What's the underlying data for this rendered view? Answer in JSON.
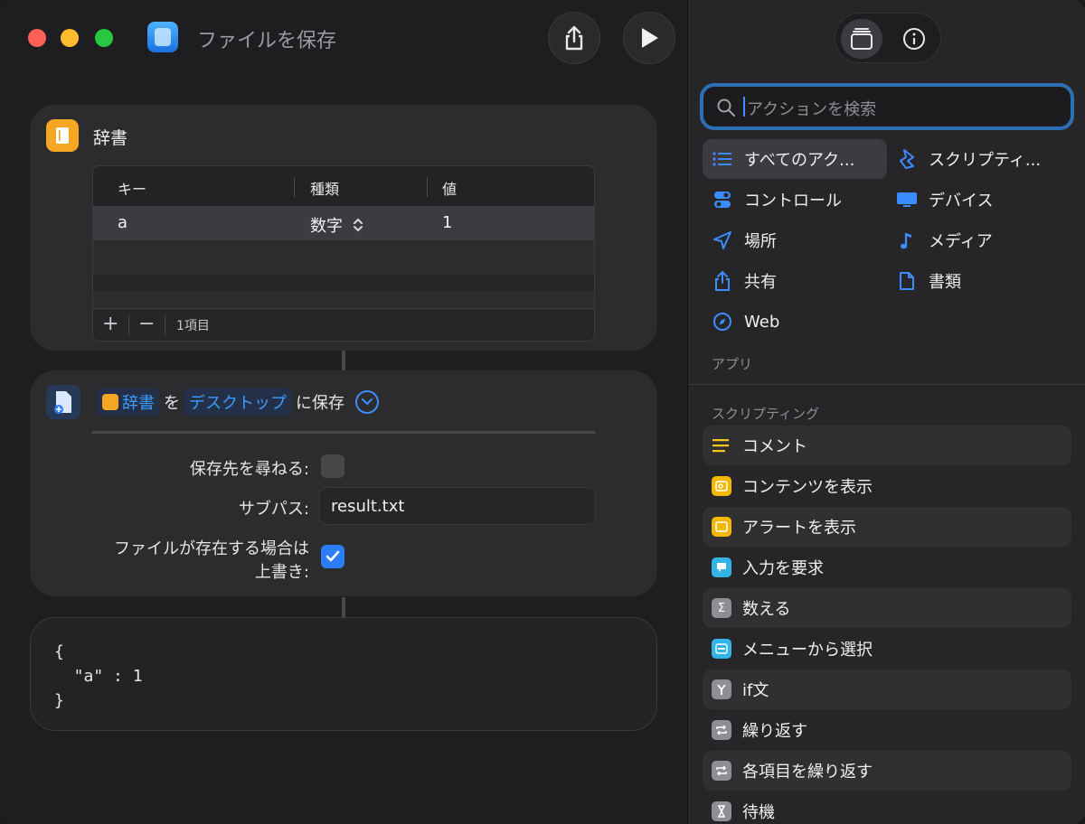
{
  "window": {
    "title": "ファイルを保存"
  },
  "dict_card": {
    "title": "辞書",
    "columns": [
      "キー",
      "種類",
      "値"
    ],
    "row": {
      "key": "a",
      "type": "数字",
      "value": "1"
    },
    "count": "1項目"
  },
  "save_card": {
    "token_dict": "辞書",
    "word_o": "を",
    "token_dest": "デスクトップ",
    "word_save": "に保存",
    "ask_label": "保存先を尋ねる:",
    "subpath_label": "サブパス:",
    "subpath_value": "result.txt",
    "overwrite_label_1": "ファイルが存在する場合は",
    "overwrite_label_2": "上書き:",
    "ask_checked": false,
    "overwrite_checked": true
  },
  "output": {
    "line1": "{",
    "line2": "  \"a\" : 1",
    "line3": "}"
  },
  "sidebar": {
    "search_placeholder": "アクションを検索",
    "categories": [
      {
        "label": "すべてのアク...",
        "icon": "list-icon"
      },
      {
        "label": "スクリプティ...",
        "icon": "scripting-icon"
      },
      {
        "label": "コントロール",
        "icon": "toggle-icon"
      },
      {
        "label": "デバイス",
        "icon": "display-icon"
      },
      {
        "label": "場所",
        "icon": "location-icon"
      },
      {
        "label": "メディア",
        "icon": "music-note-icon"
      },
      {
        "label": "共有",
        "icon": "share-icon"
      },
      {
        "label": "書類",
        "icon": "document-icon"
      },
      {
        "label": "Web",
        "icon": "compass-icon"
      }
    ],
    "apps_label": "アプリ",
    "scripting_label": "スクリプティング",
    "actions": [
      {
        "label": "コメント",
        "color": "#f5c518"
      },
      {
        "label": "コンテンツを表示",
        "color": "#f5b800"
      },
      {
        "label": "アラートを表示",
        "color": "#f5b800"
      },
      {
        "label": "入力を要求",
        "color": "#32b4e6"
      },
      {
        "label": "数える",
        "color": "#8e8e93"
      },
      {
        "label": "メニューから選択",
        "color": "#32b4e6"
      },
      {
        "label": "if文",
        "color": "#8e8e93"
      },
      {
        "label": "繰り返す",
        "color": "#8e8e93"
      },
      {
        "label": "各項目を繰り返す",
        "color": "#8e8e93"
      },
      {
        "label": "待機",
        "color": "#8e8e93"
      }
    ]
  }
}
